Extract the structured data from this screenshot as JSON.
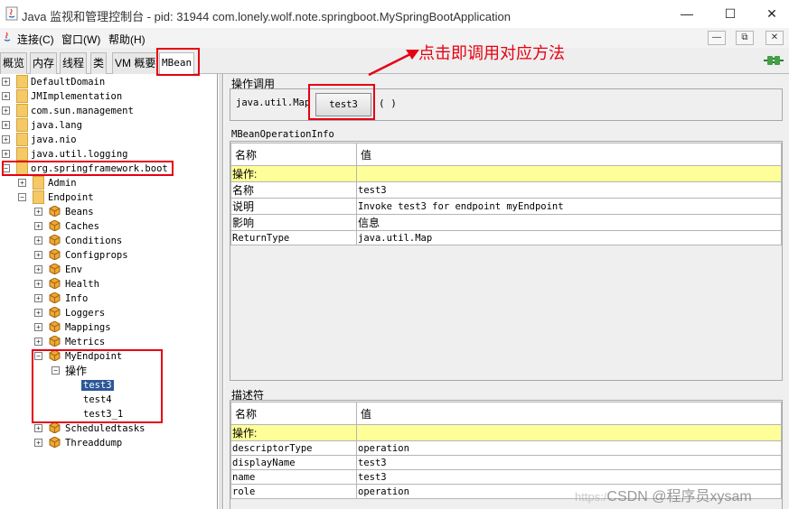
{
  "window": {
    "title": "Java 监视和管理控制台 - pid: 31944 com.lonely.wolf.note.springboot.MySpringBootApplication",
    "controls": {
      "minimize": "—",
      "maximize": "☐",
      "close": "✕"
    }
  },
  "menu": {
    "items": [
      "连接(C)",
      "窗口(W)",
      "帮助(H)"
    ],
    "mdi_controls": [
      "—",
      "⧉",
      "✕"
    ]
  },
  "tabs": [
    "概览",
    "内存",
    "线程",
    "类",
    "VM 概要",
    "MBean"
  ],
  "active_tab": "MBean",
  "tree": {
    "domains": [
      "DefaultDomain",
      "JMImplementation",
      "com.sun.management",
      "java.lang",
      "java.nio",
      "java.util.logging",
      "org.springframework.boot"
    ],
    "boot_children": [
      "Admin",
      "Endpoint"
    ],
    "endpoint_children_before": [
      "Beans",
      "Caches",
      "Conditions",
      "Configprops",
      "Env",
      "Health",
      "Info",
      "Loggers",
      "Mappings",
      "Metrics"
    ],
    "my_endpoint": "MyEndpoint",
    "operations_label": "操作",
    "operations": [
      "test3",
      "test4",
      "test3_1"
    ],
    "selected_operation": "test3",
    "endpoint_children_after": [
      "Scheduledtasks",
      "Threaddump"
    ]
  },
  "operation_invoke": {
    "section_title": "操作调用",
    "return_type": "java.util.Map",
    "button_label": "test3",
    "params": "( )"
  },
  "operation_info": {
    "section_title": "MBeanOperationInfo",
    "headers": [
      "名称",
      "值"
    ],
    "group_row": "操作:",
    "rows": [
      [
        "名称",
        "test3"
      ],
      [
        "说明",
        "Invoke test3 for endpoint myEndpoint"
      ],
      [
        "影响",
        "信息"
      ],
      [
        "ReturnType",
        "java.util.Map"
      ]
    ]
  },
  "descriptor": {
    "section_title": "描述符",
    "headers": [
      "名称",
      "值"
    ],
    "group_row": "操作:",
    "rows": [
      [
        "descriptorType",
        "operation"
      ],
      [
        "displayName",
        "test3"
      ],
      [
        "name",
        "test3"
      ],
      [
        "role",
        "operation"
      ]
    ]
  },
  "annotation": {
    "text": "点击即调用对应方法",
    "color": "#e60012"
  },
  "watermark": {
    "faint": "https:/",
    "text": "CSDN @程序员xysam"
  },
  "colors": {
    "highlight_row": "#ffff99",
    "selection": "#2b5797",
    "annotation_red": "#e60012"
  }
}
